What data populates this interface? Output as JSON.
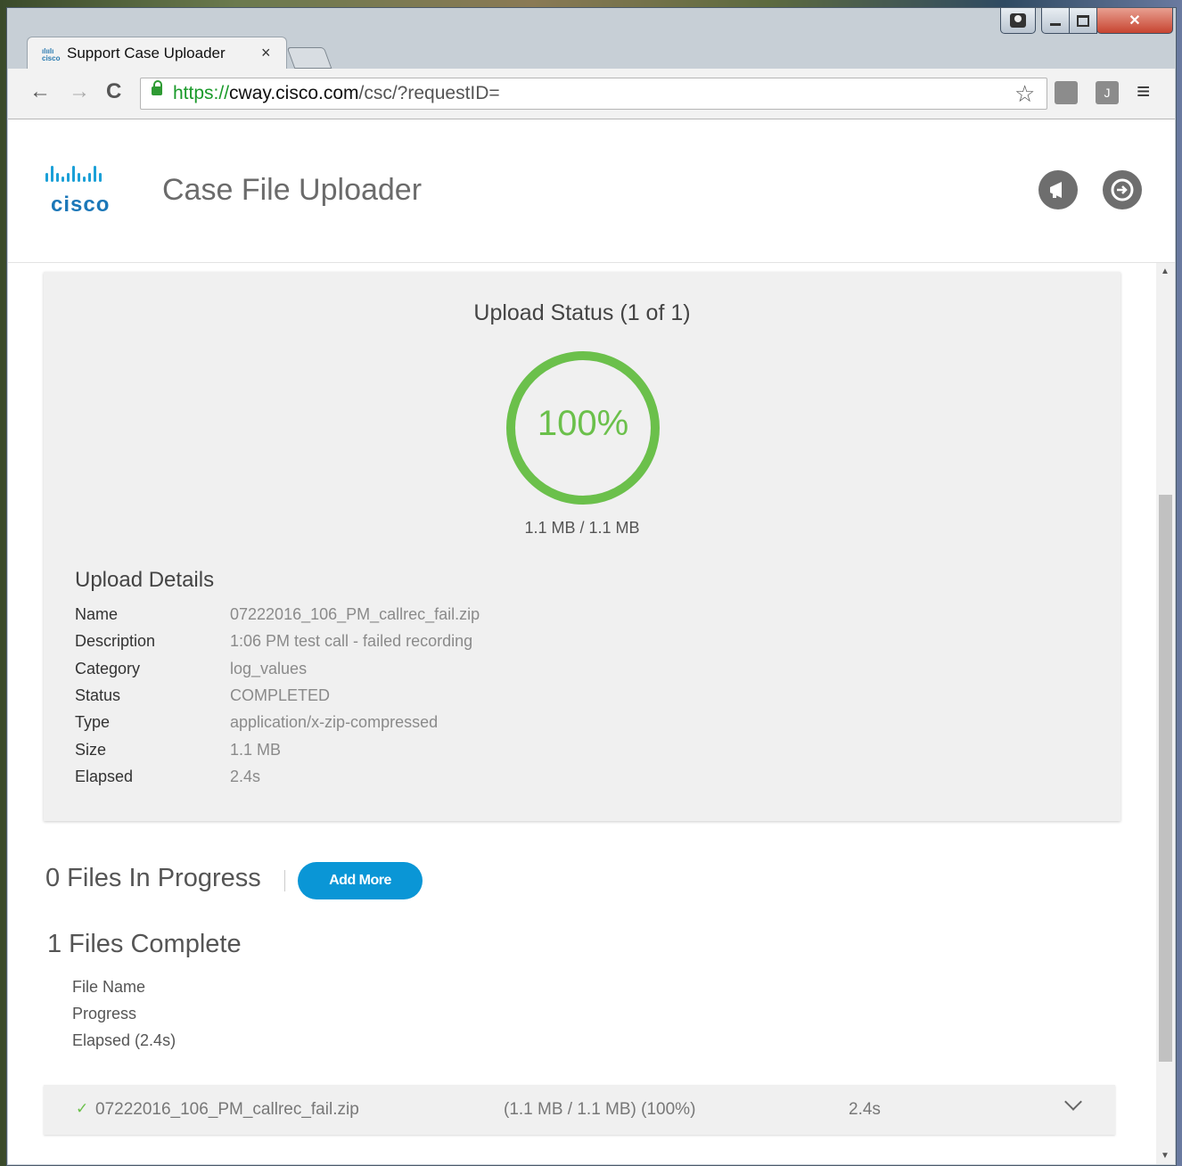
{
  "browser": {
    "tab_title": "Support Case Uploader",
    "tab_favicon": "cisco",
    "tab_close": "×",
    "url_scheme": "https://",
    "url_host": "cway.cisco.com",
    "url_path": "/csc/?requestID=",
    "nav": {
      "back": "←",
      "forward": "→",
      "reload": "C"
    },
    "star_icon": "☆",
    "menu_icon": "≡",
    "ext2_label": "J",
    "window_close": "✕"
  },
  "header": {
    "logo_text": "cisco",
    "app_title": "Case File Uploader",
    "icons": [
      "megaphone-icon",
      "logout-icon"
    ]
  },
  "upload_status": {
    "title": "Upload Status (1 of 1)",
    "progress_percent": 100,
    "progress_label": "100%",
    "size_label": "1.1 MB / 1.1 MB",
    "ring_color": "#6bc04b"
  },
  "upload_details": {
    "title": "Upload Details",
    "rows": [
      {
        "key": "Name",
        "value": "07222016_106_PM_callrec_fail.zip"
      },
      {
        "key": "Description",
        "value": "1:06 PM test call - failed recording"
      },
      {
        "key": "Category",
        "value": "log_values"
      },
      {
        "key": "Status",
        "value": "COMPLETED"
      },
      {
        "key": "Type",
        "value": "application/x-zip-compressed"
      },
      {
        "key": "Size",
        "value": "1.1 MB"
      },
      {
        "key": "Elapsed",
        "value": "2.4s"
      }
    ]
  },
  "in_progress": {
    "title": "0 Files In Progress",
    "add_more_label": "Add More",
    "button_color": "#0a96d6"
  },
  "complete": {
    "title": "1 Files Complete",
    "columns": [
      "File Name",
      "Progress",
      "Elapsed (2.4s)"
    ],
    "files": [
      {
        "check": "✓",
        "name": "07222016_106_PM_callrec_fail.zip",
        "progress": "(1.1 MB / 1.1 MB) (100%)",
        "elapsed": "2.4s"
      }
    ]
  }
}
